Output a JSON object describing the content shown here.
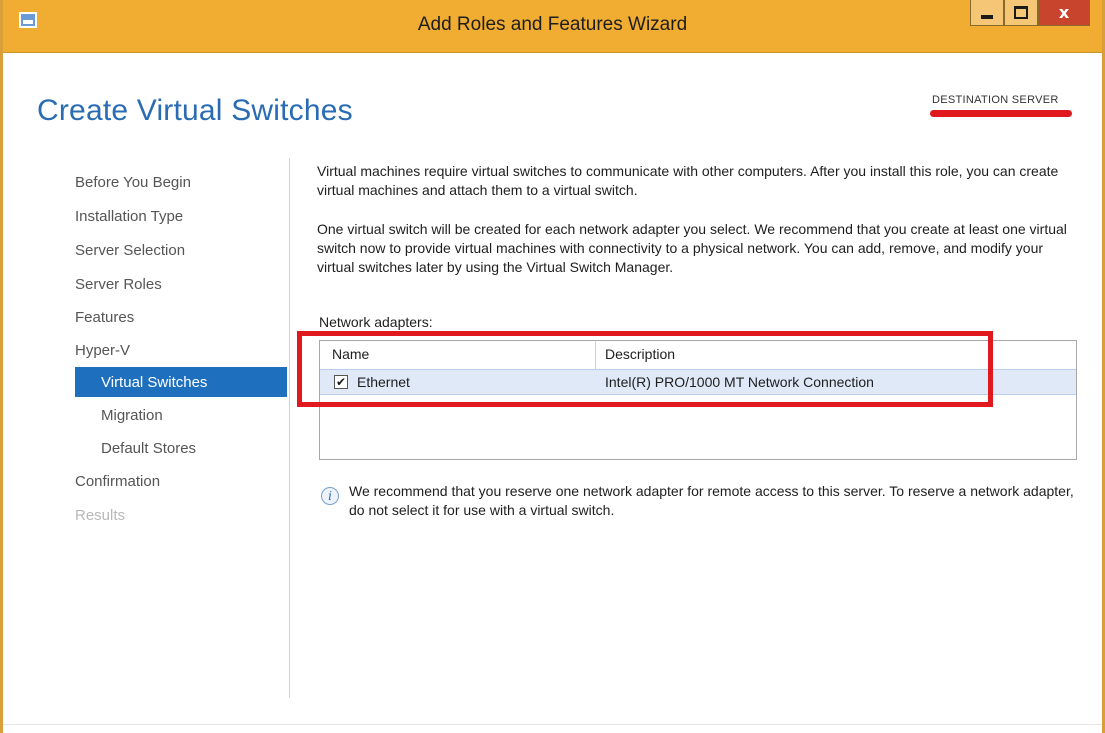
{
  "window": {
    "title": "Add Roles and Features Wizard",
    "accent_color": "#f0ad32",
    "controls": {
      "minimize_icon": "minimize-icon",
      "maximize_icon": "maximize-icon",
      "close_icon": "close-icon",
      "close_glyph": "x"
    }
  },
  "header": {
    "page_title": "Create Virtual Switches",
    "destination_label": "DESTINATION SERVER"
  },
  "nav": {
    "items": [
      {
        "label": "Before You Begin",
        "state": "normal"
      },
      {
        "label": "Installation Type",
        "state": "normal"
      },
      {
        "label": "Server Selection",
        "state": "normal"
      },
      {
        "label": "Server Roles",
        "state": "normal"
      },
      {
        "label": "Features",
        "state": "normal"
      },
      {
        "label": "Hyper-V",
        "state": "normal"
      },
      {
        "label": "Virtual Switches",
        "state": "selected"
      },
      {
        "label": "Migration",
        "state": "normal"
      },
      {
        "label": "Default Stores",
        "state": "normal"
      },
      {
        "label": "Confirmation",
        "state": "normal"
      },
      {
        "label": "Results",
        "state": "disabled"
      }
    ]
  },
  "content": {
    "paragraph1": "Virtual machines require virtual switches to communicate with other computers. After you install this role, you can create virtual machines and attach them to a virtual switch.",
    "paragraph2": "One virtual switch will be created for each network adapter you select. We recommend that you create at least one virtual switch now to provide virtual machines with connectivity to a physical network. You can add, remove, and modify your virtual switches later by using the Virtual Switch Manager.",
    "adapters_label": "Network adapters:",
    "table": {
      "columns": [
        "Name",
        "Description"
      ],
      "rows": [
        {
          "checked": true,
          "name": "Ethernet",
          "description": "Intel(R) PRO/1000 MT Network Connection"
        }
      ]
    },
    "info_glyph": "i",
    "info_text": "We recommend that you reserve one network adapter for remote access to this server. To reserve a network adapter, do not select it for use with a virtual switch."
  },
  "glyphs": {
    "checkmark": "✔"
  },
  "colors": {
    "highlight_annotation": "#e0191e",
    "selection": "#1f6fbf",
    "title_blue": "#2a6cb3"
  }
}
